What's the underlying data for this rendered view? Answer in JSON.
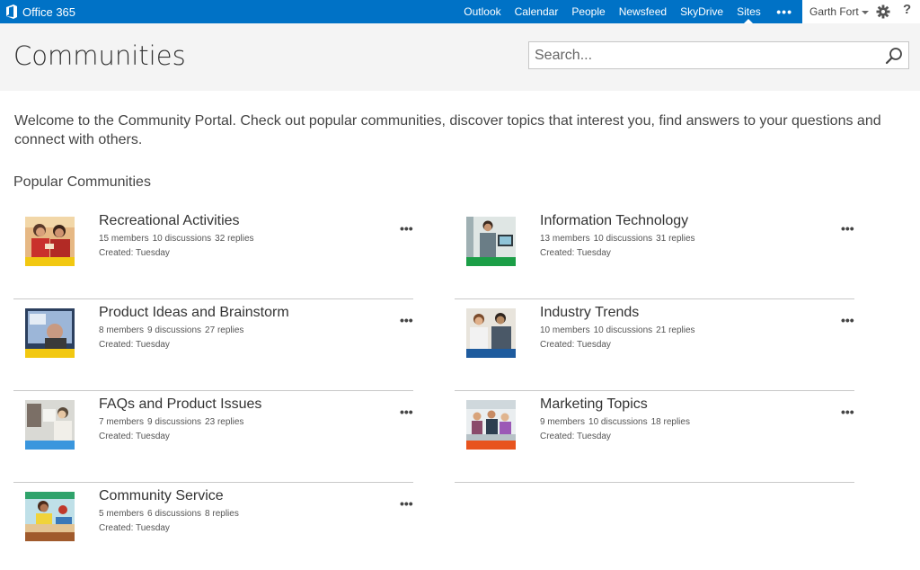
{
  "suitebar": {
    "brand": "Office 365",
    "nav": [
      "Outlook",
      "Calendar",
      "People",
      "Newsfeed",
      "SkyDrive",
      "Sites"
    ],
    "active": "Sites",
    "more": "•••",
    "user": "Garth Fort",
    "help": "?"
  },
  "header": {
    "title": "Communities",
    "search_placeholder": "Search..."
  },
  "welcome": "Welcome to the Community Portal. Check out popular communities, discover topics that interest you, find answers to your questions and connect with others.",
  "section_title": "Popular Communities",
  "communities": [
    {
      "name": "Recreational Activities",
      "members": "15 members",
      "discussions": "10 discussions",
      "replies": "32 replies",
      "created": "Created: Tuesday",
      "bar_color": "#f2c811",
      "photo_colors": [
        "#c9312c",
        "#e8a14b",
        "#5a3a2a"
      ]
    },
    {
      "name": "Product Ideas and Brainstorm",
      "members": "8 members",
      "discussions": "9 discussions",
      "replies": "27 replies",
      "created": "Created: Tuesday",
      "bar_color": "#f2c811",
      "photo_colors": [
        "#2b3f5e",
        "#9cb6d8",
        "#c89a82"
      ]
    },
    {
      "name": "FAQs and Product Issues",
      "members": "7 members",
      "discussions": "9 discussions",
      "replies": "23 replies",
      "created": "Created: Tuesday",
      "bar_color": "#3a96dd",
      "photo_colors": [
        "#d9d9d4",
        "#7b6f66",
        "#e6c6a3"
      ]
    },
    {
      "name": "Community Service",
      "members": "5 members",
      "discussions": "6 discussions",
      "replies": "8 replies",
      "created": "Created: Tuesday",
      "bar_color": "#a05a2c",
      "photo_colors": [
        "#2fa36b",
        "#f0d33a",
        "#c0392b"
      ]
    },
    {
      "name": "Information Technology",
      "members": "13 members",
      "discussions": "10 discussions",
      "replies": "31 replies",
      "created": "Created: Tuesday",
      "bar_color": "#1b9e47",
      "photo_colors": [
        "#dfe6e4",
        "#6a7d86",
        "#c79572"
      ]
    },
    {
      "name": "Industry Trends",
      "members": "10 members",
      "discussions": "10 discussions",
      "replies": "21 replies",
      "created": "Created: Tuesday",
      "bar_color": "#1e5b9e",
      "photo_colors": [
        "#e8e4dc",
        "#b68a63",
        "#4a5867"
      ]
    },
    {
      "name": "Marketing Topics",
      "members": "9 members",
      "discussions": "10 discussions",
      "replies": "18 replies",
      "created": "Created: Tuesday",
      "bar_color": "#e8541e",
      "photo_colors": [
        "#eaeef0",
        "#8a4b6b",
        "#d8a37a"
      ]
    }
  ],
  "item_more": "•••"
}
